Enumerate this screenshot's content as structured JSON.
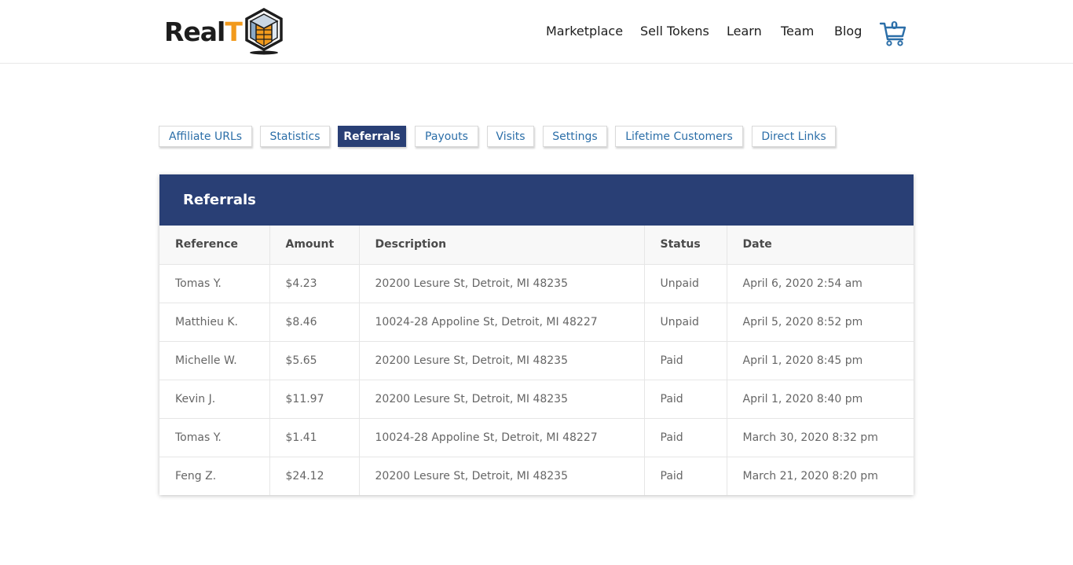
{
  "header": {
    "logo_real": "Real",
    "logo_t": "T",
    "nav": [
      "Marketplace",
      "Sell Tokens",
      "Learn",
      "Team",
      "Blog"
    ],
    "cart_count": "0",
    "icons": {
      "logo": "realt-cube-logo-icon",
      "cart": "shopping-cart-icon"
    }
  },
  "tabs": [
    "Affiliate URLs",
    "Statistics",
    "Referrals",
    "Payouts",
    "Visits",
    "Settings",
    "Lifetime Customers",
    "Direct Links"
  ],
  "active_tab": "Referrals",
  "referrals": {
    "title": "Referrals",
    "columns": [
      "Reference",
      "Amount",
      "Description",
      "Status",
      "Date"
    ],
    "rows": [
      [
        "Tomas Y.",
        "$4.23",
        "20200 Lesure St, Detroit, MI 48235",
        "Unpaid",
        "April 6, 2020 2:54 am"
      ],
      [
        "Matthieu K.",
        "$8.46",
        "10024-28 Appoline St, Detroit, MI 48227",
        "Unpaid",
        "April 5, 2020 8:52 pm"
      ],
      [
        "Michelle W.",
        "$5.65",
        "20200 Lesure St, Detroit, MI 48235",
        "Paid",
        "April 1, 2020 8:45 pm"
      ],
      [
        "Kevin J.",
        "$11.97",
        "20200 Lesure St, Detroit, MI 48235",
        "Paid",
        "April 1, 2020 8:40 pm"
      ],
      [
        "Tomas Y.",
        "$1.41",
        "10024-28 Appoline St, Detroit, MI 48227",
        "Paid",
        "March 30, 2020 8:32 pm"
      ],
      [
        "Feng Z.",
        "$24.12",
        "20200 Lesure St, Detroit, MI 48235",
        "Paid",
        "March 21, 2020 8:20 pm"
      ]
    ]
  },
  "colors": {
    "primary": "#293f75",
    "link": "#2b6ea8",
    "accent": "#f29a1c"
  }
}
